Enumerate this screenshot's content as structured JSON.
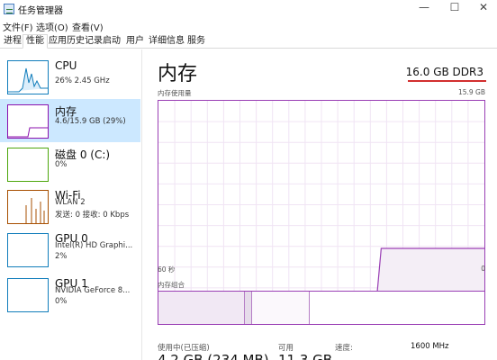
{
  "window": {
    "title": "任务管理器",
    "min_glyph": "—",
    "max_glyph": "☐",
    "close_glyph": "✕"
  },
  "menu": [
    "文件(F)",
    "选项(O)",
    "查看(V)"
  ],
  "tabs": [
    "进程",
    "性能",
    "应用历史记录",
    "启动",
    "用户",
    "详细信息",
    "服务"
  ],
  "active_tab": "性能",
  "sidebar": [
    {
      "name": "CPU",
      "line1": "26% 2.45 GHz",
      "line2": "",
      "color": "#117dbb",
      "thumb_fill": 0.26
    },
    {
      "name": "内存",
      "line1": "4.6/15.9 GB (29%)",
      "line2": "",
      "color": "#8b12ae",
      "thumb_fill": 0.29
    },
    {
      "name": "磁盘 0 (C:)",
      "line1": "0%",
      "line2": "",
      "color": "#4da60c",
      "thumb_fill": 0
    },
    {
      "name": "Wi-Fi",
      "line1": "WLAN 2",
      "line2": "发送: 0 接收: 0 Kbps",
      "color": "#a74f01",
      "thumb_fill": 0
    },
    {
      "name": "GPU 0",
      "line1": "Intel(R) HD Graphi...",
      "line2": "2%",
      "color": "#117dbb",
      "thumb_fill": 0.02
    },
    {
      "name": "GPU 1",
      "line1": "NVIDIA GeForce 8...",
      "line2": "0%",
      "color": "#117dbb",
      "thumb_fill": 0
    }
  ],
  "main": {
    "title": "内存",
    "spec": "16.0 GB DDR3",
    "usage_label": "内存使用量",
    "usage_max": "15.9 GB",
    "time_label": "60 秒",
    "zero_label": "0",
    "composition_label": "内存组合",
    "accent_color": "#9a3fb5",
    "usage_series": {
      "x_seconds_ago": [
        60,
        20,
        19,
        0
      ],
      "used_fraction": [
        0,
        0,
        0.29,
        0.29
      ]
    },
    "stats": {
      "in_use_label": "使用中(已压缩)",
      "in_use_value": "4.2 GB (234 MB)",
      "available_label": "可用",
      "available_value": "11.3 GB",
      "speed_label": "速度:",
      "speed_value": "1600 MHz"
    }
  }
}
